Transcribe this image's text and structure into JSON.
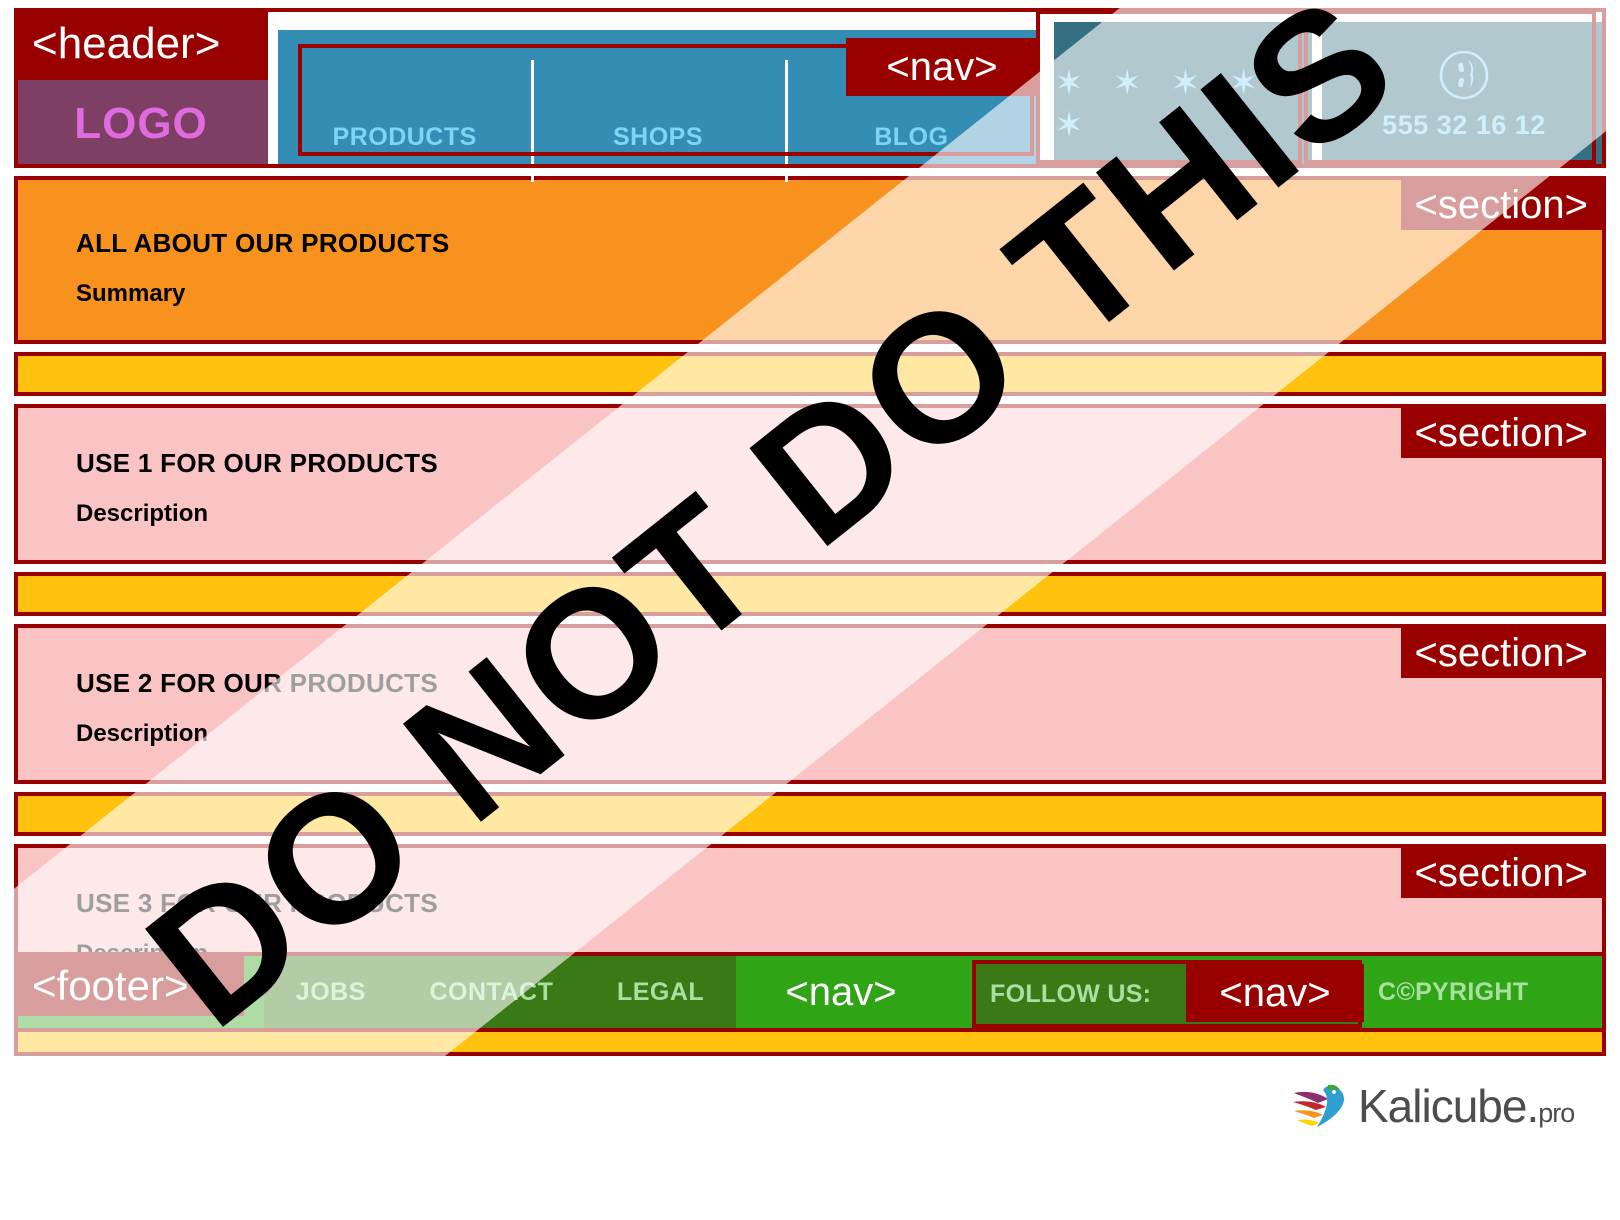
{
  "header": {
    "tag": "<header>",
    "logo": "LOGO",
    "nav_tag": "<nav>",
    "nav_items": [
      {
        "label": "PRODUCTS"
      },
      {
        "label": "SHOPS"
      },
      {
        "label": "BLOG"
      }
    ],
    "stars": "✶ ✶ ✶ ✶ ✶",
    "stars_count": 5,
    "phone_icon": "phone-icon",
    "phone": "555 32 16 12"
  },
  "sections": [
    {
      "tag": "<section>",
      "title": "ALL ABOUT OUR PRODUCTS",
      "body": "Summary",
      "color": "#f7921e"
    },
    {
      "tag": "<section>",
      "title": "USE 1 FOR OUR PRODUCTS",
      "body": "Description",
      "color": "#fac4c4"
    },
    {
      "tag": "<section>",
      "title": "USE 2 FOR OUR PRODUCTS",
      "body": "Description",
      "color": "#fac4c4"
    },
    {
      "tag": "<section>",
      "title": "USE 3 FOR OUR PRODUCTS",
      "body": "Description",
      "color": "#fac4c4"
    }
  ],
  "footer": {
    "tag": "<footer>",
    "nav_tag": "<nav>",
    "social_nav_tag": "<nav>",
    "links": [
      {
        "label": "JOBS"
      },
      {
        "label": "CONTACT"
      },
      {
        "label": "LEGAL"
      }
    ],
    "follow_label": "FOLLOW US:",
    "social_icons": [
      {
        "name": "social-pin-icon-1"
      },
      {
        "name": "social-pin-icon-2"
      },
      {
        "name": "social-pin-icon-3"
      }
    ],
    "copyright": "C©PYRIGHT"
  },
  "overlay": {
    "watermark": "DO NOT DO THIS"
  },
  "branding": {
    "logo_icon": "kalicube-bird-icon",
    "name": "Kalicube",
    "dot": ".",
    "tld": "pro"
  },
  "colors": {
    "tag_red": "#990000",
    "logo_purple": "#7d3f63",
    "logo_text": "#e06be0",
    "nav_blue": "#338db5",
    "nav_text": "#7fd4f5",
    "teal": "#357082",
    "orange": "#f7921e",
    "yellow": "#ffc20e",
    "pink": "#fac4c4",
    "footer_green": "#2fa414",
    "footer_panel_green": "#3a7a16",
    "footer_text": "#a9dfa0"
  }
}
